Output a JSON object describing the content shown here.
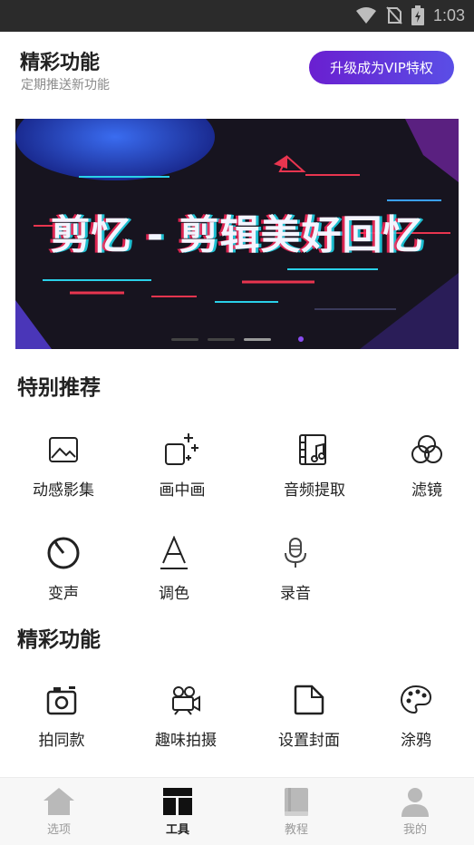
{
  "status_bar": {
    "time": "1:03"
  },
  "header": {
    "title": "精彩功能",
    "subtitle": "定期推送新功能",
    "vip_button": "升级成为VIP特权"
  },
  "banner": {
    "text": "剪忆 - 剪辑美好回忆",
    "page_count": 4,
    "active_page": 2
  },
  "special": {
    "title": "特别推荐",
    "items": [
      {
        "label": "动感影集",
        "icon": "photo-album-icon"
      },
      {
        "label": "画中画",
        "icon": "picture-in-picture-icon"
      },
      {
        "label": "音频提取",
        "icon": "audio-extract-icon"
      },
      {
        "label": "滤镜",
        "icon": "filter-icon"
      },
      {
        "label": "变声",
        "icon": "voice-change-icon"
      },
      {
        "label": "调色",
        "icon": "color-adjust-icon"
      },
      {
        "label": "录音",
        "icon": "microphone-icon"
      }
    ]
  },
  "featured": {
    "title": "精彩功能",
    "items": [
      {
        "label": "拍同款",
        "icon": "camera-icon"
      },
      {
        "label": "趣味拍摄",
        "icon": "movie-camera-icon"
      },
      {
        "label": "设置封面",
        "icon": "cover-icon"
      },
      {
        "label": "涂鸦",
        "icon": "palette-icon"
      }
    ]
  },
  "nav": {
    "items": [
      {
        "label": "选项",
        "icon": "home-icon",
        "active": false
      },
      {
        "label": "工具",
        "icon": "tools-icon",
        "active": true
      },
      {
        "label": "教程",
        "icon": "book-icon",
        "active": false
      },
      {
        "label": "我的",
        "icon": "profile-icon",
        "active": false
      }
    ]
  },
  "colors": {
    "accent": "#5b3fe0",
    "status_bar": "#2b2b2b"
  }
}
